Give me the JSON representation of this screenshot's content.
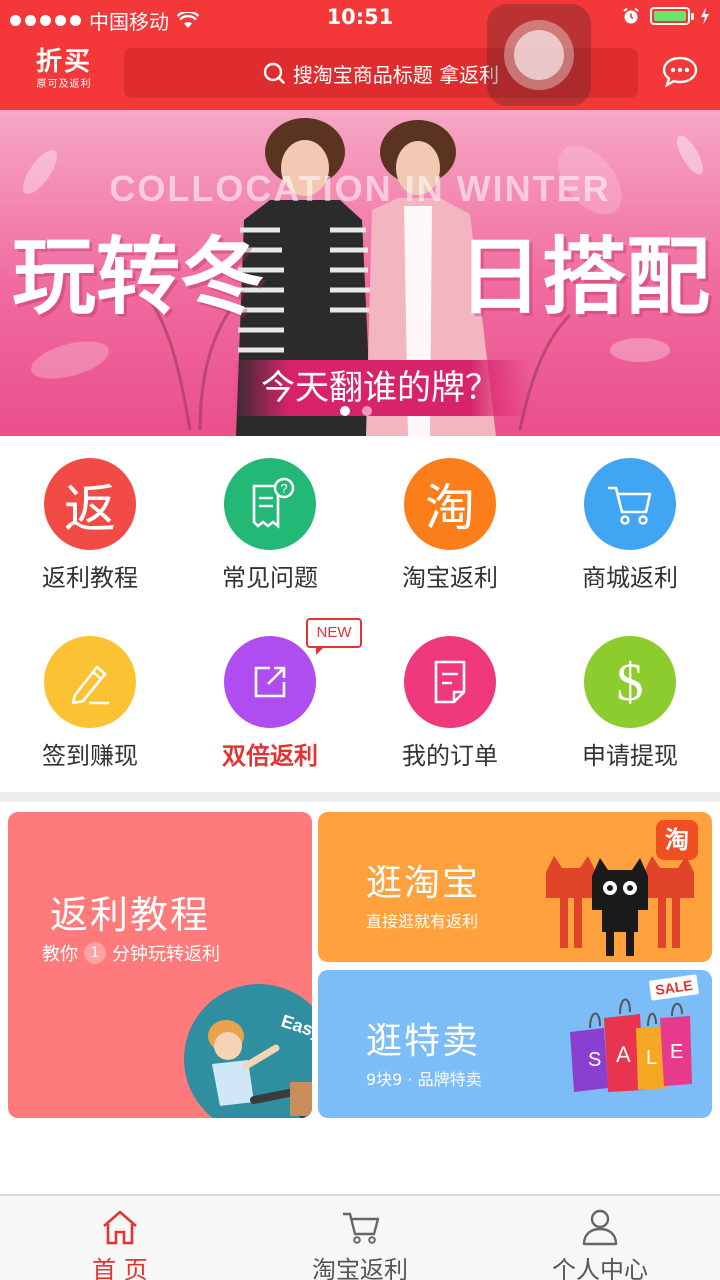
{
  "status_bar": {
    "carrier": "中国移动",
    "time": "10:51"
  },
  "header": {
    "logo_main": "折买",
    "logo_sub": "原可及返利",
    "search_placeholder": "搜淘宝商品标题 拿返利"
  },
  "banner": {
    "english": "COLLOCATION IN WINTER",
    "left_text": "玩转冬",
    "right_text": "日搭配",
    "tagline": "今天翻谁的牌？"
  },
  "grid": {
    "items": [
      {
        "label": "返利教程",
        "icon": "fan-char-icon",
        "glyph": "返",
        "color": "#f24a45"
      },
      {
        "label": "常见问题",
        "icon": "faq-receipt-icon",
        "color": "#23b876"
      },
      {
        "label": "淘宝返利",
        "icon": "tao-char-icon",
        "glyph": "淘",
        "color": "#fb7e1b"
      },
      {
        "label": "商城返利",
        "icon": "cart-icon",
        "color": "#40a6f4"
      },
      {
        "label": "签到赚现",
        "icon": "pencil-icon",
        "color": "#fbc233"
      },
      {
        "label": "双倍返利",
        "icon": "share-icon",
        "color": "#b04df0",
        "badge": "NEW"
      },
      {
        "label": "我的订单",
        "icon": "order-doc-icon",
        "color": "#f0397c"
      },
      {
        "label": "申请提现",
        "icon": "dollar-icon",
        "glyph": "$",
        "color": "#8ccc2e"
      }
    ]
  },
  "promos": {
    "tutorial": {
      "title": "返利教程",
      "subtitle_pre": "教你",
      "subtitle_num": "1",
      "subtitle_post": "分钟玩转返利",
      "sticker": "Easy!"
    },
    "taobao": {
      "title": "逛淘宝",
      "subtitle": "直接逛就有返利",
      "badge": "淘"
    },
    "sale": {
      "title": "逛特卖",
      "subtitle": "9块9 · 品牌特卖",
      "sticker": "SALE",
      "bag_letters": [
        "S",
        "A",
        "L",
        "E"
      ]
    }
  },
  "tabbar": {
    "tabs": [
      {
        "label": "首 页",
        "active": true
      },
      {
        "label": "淘宝返利",
        "active": false
      },
      {
        "label": "个人中心",
        "active": false
      }
    ]
  }
}
